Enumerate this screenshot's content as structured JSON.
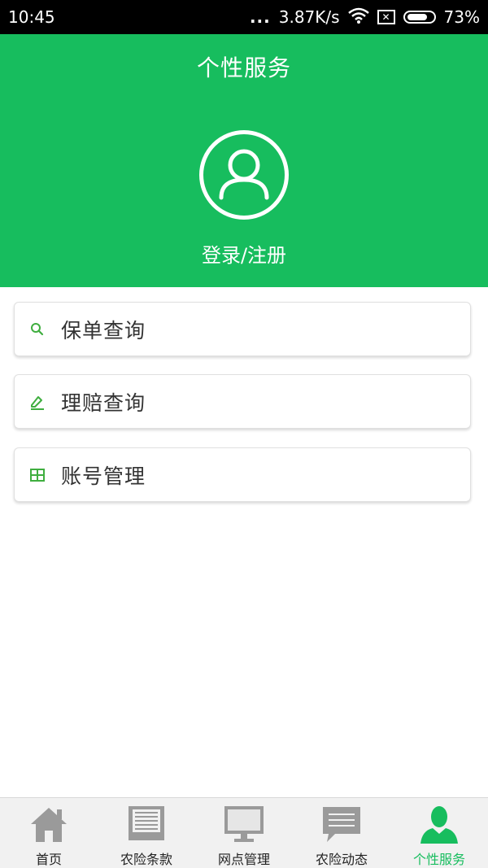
{
  "status_bar": {
    "time": "10:45",
    "dots": "...",
    "speed": "3.87K/s",
    "battery": "73%"
  },
  "header": {
    "title": "个性服务",
    "login_label": "登录/注册"
  },
  "menu": [
    {
      "label": "保单查询",
      "icon": "search-icon"
    },
    {
      "label": "理赔查询",
      "icon": "edit-icon"
    },
    {
      "label": "账号管理",
      "icon": "grid-icon"
    }
  ],
  "bottom_nav": [
    {
      "label": "首页",
      "icon": "home-icon",
      "active": false
    },
    {
      "label": "农险条款",
      "icon": "document-icon",
      "active": false
    },
    {
      "label": "网点管理",
      "icon": "monitor-icon",
      "active": false
    },
    {
      "label": "农险动态",
      "icon": "message-icon",
      "active": false
    },
    {
      "label": "个性服务",
      "icon": "user-icon",
      "active": true
    }
  ],
  "colors": {
    "brand_green": "#17bd5e",
    "icon_green": "#3fae3f",
    "nav_gray": "#9a9a9a"
  }
}
